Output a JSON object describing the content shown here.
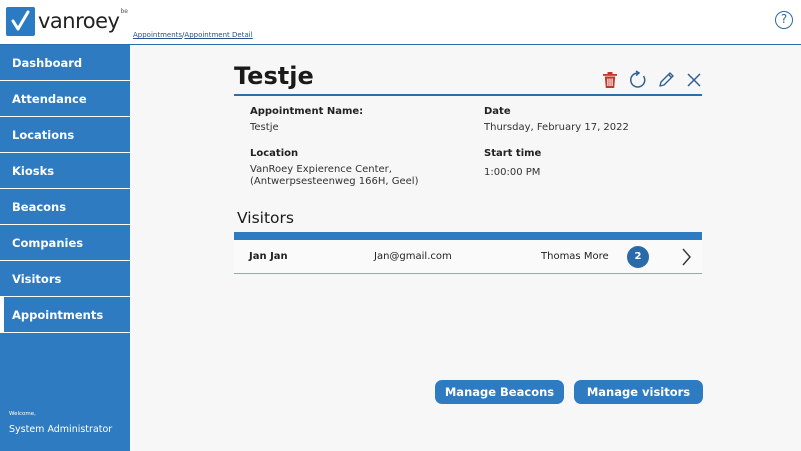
{
  "header": {
    "logo_text": "vanroey",
    "logo_suffix": "be",
    "breadcrumb": [
      "Appointments",
      "Appointment Detail"
    ],
    "breadcrumb_sep": "/",
    "help_icon": "help-icon"
  },
  "sidebar": {
    "items": [
      {
        "label": "Dashboard"
      },
      {
        "label": "Attendance"
      },
      {
        "label": "Locations"
      },
      {
        "label": "Kiosks"
      },
      {
        "label": "Beacons"
      },
      {
        "label": "Companies"
      },
      {
        "label": "Visitors"
      },
      {
        "label": "Appointments",
        "active": true
      }
    ],
    "welcome_label": "Welcome,",
    "user_name": "System Administrator"
  },
  "detail": {
    "title": "Testje",
    "actions": [
      "delete-icon",
      "refresh-icon",
      "edit-icon",
      "close-icon"
    ],
    "fields": {
      "name_label": "Appointment Name:",
      "name_value": "Testje",
      "date_label": "Date",
      "date_value": "Thursday, February 17, 2022",
      "location_label": "Location",
      "location_value_line1": "VanRoey Expierence Center,",
      "location_value_line2": "(Antwerpsesteenweg 166H, Geel)",
      "start_label": "Start time",
      "start_value": "1:00:00 PM"
    }
  },
  "visitors": {
    "heading": "Visitors",
    "rows": [
      {
        "name": "Jan Jan",
        "email": "Jan@gmail.com",
        "company": "Thomas More",
        "count": "2"
      }
    ]
  },
  "buttons": {
    "manage_beacons": "Manage Beacons",
    "manage_visitors": "Manage visitors"
  },
  "colors": {
    "accent": "#2f7bc1",
    "delete": "#c0392b"
  }
}
